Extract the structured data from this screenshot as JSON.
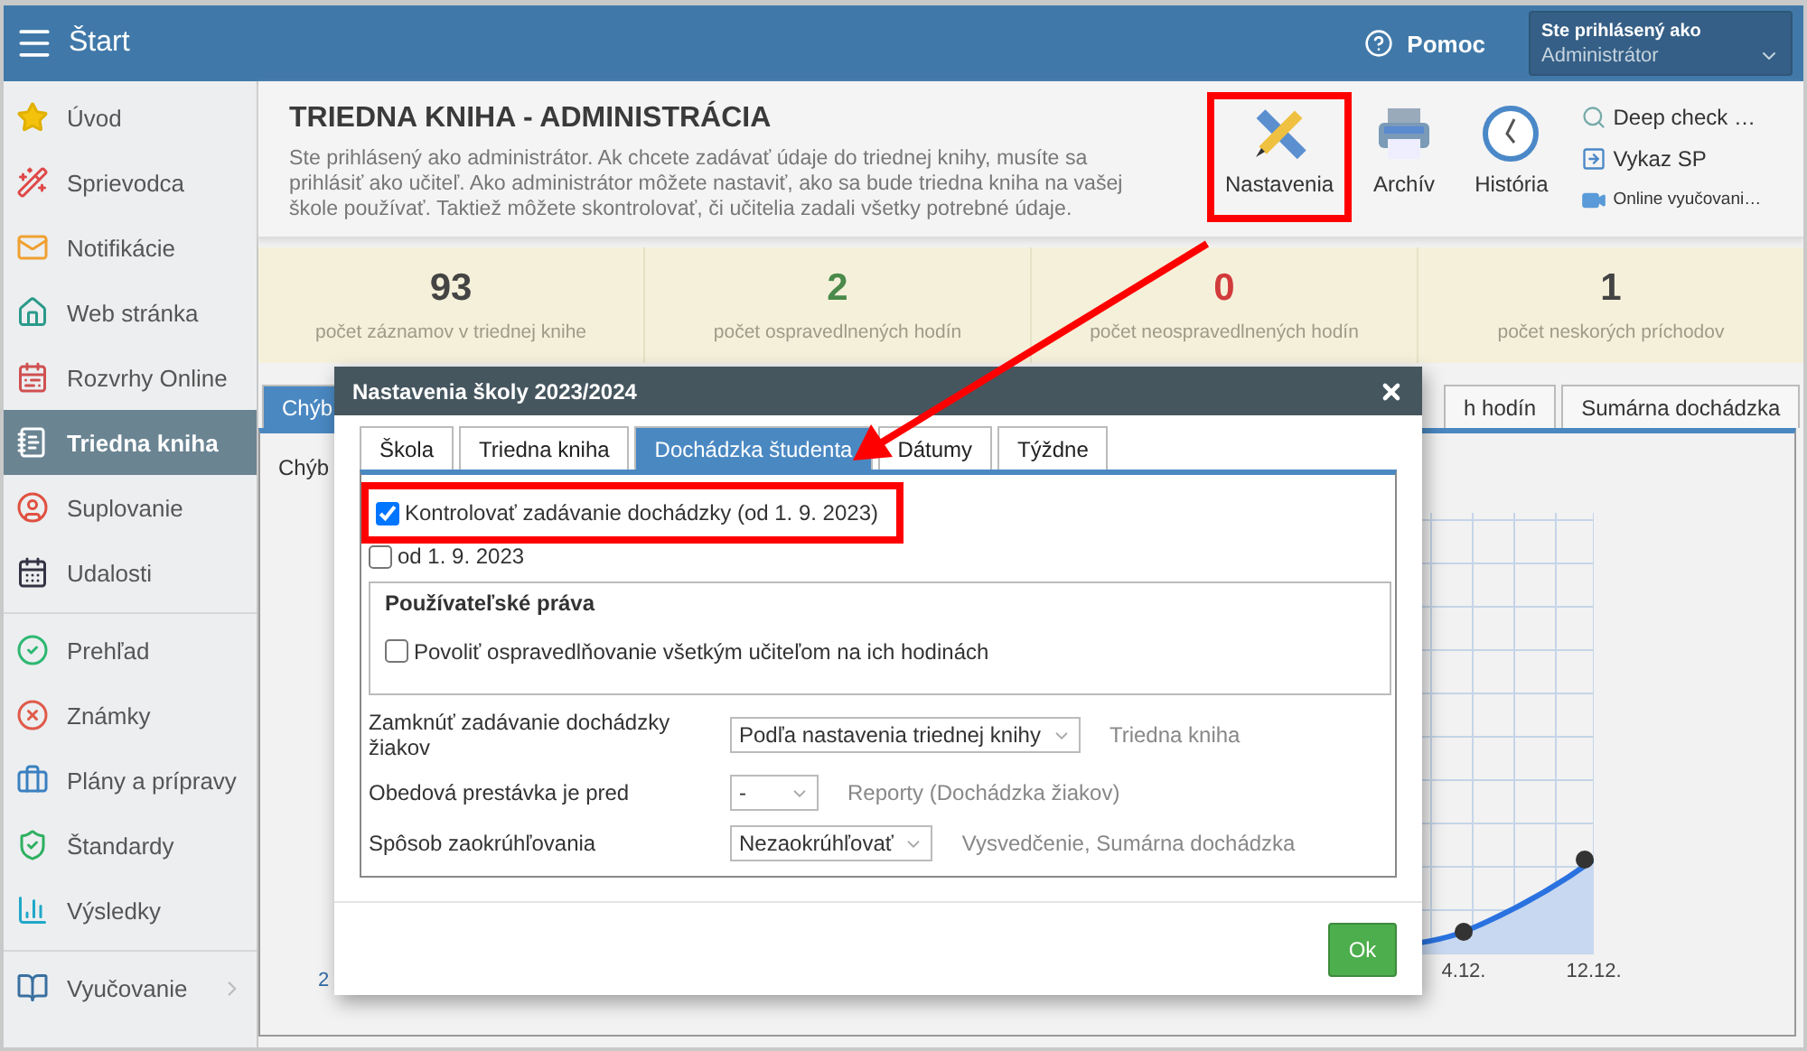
{
  "topbar": {
    "title": "Štart",
    "help": "Pomoc",
    "user_label": "Ste prihlásený ako",
    "user_name": "Administrátor"
  },
  "sidebar": {
    "sections": [
      {
        "items": [
          {
            "label": "Úvod",
            "selected": false,
            "kind": "link"
          },
          {
            "label": "Sprievodca",
            "selected": false,
            "kind": "link"
          },
          {
            "label": "Notifikácie",
            "selected": false,
            "kind": "link"
          },
          {
            "label": "Web stránka",
            "selected": false,
            "kind": "link"
          },
          {
            "label": "Rozvrhy Online",
            "selected": false,
            "kind": "link"
          },
          {
            "label": "Triedna kniha",
            "selected": true,
            "kind": "link"
          },
          {
            "label": "Suplovanie",
            "selected": false,
            "kind": "link"
          },
          {
            "label": "Udalosti",
            "selected": false,
            "kind": "link"
          }
        ]
      },
      {
        "items": [
          {
            "label": "Prehľad",
            "selected": false,
            "kind": "link"
          },
          {
            "label": "Známky",
            "selected": false,
            "kind": "link"
          },
          {
            "label": "Plány a prípravy",
            "selected": false,
            "kind": "link"
          },
          {
            "label": "Štandardy",
            "selected": false,
            "kind": "link"
          },
          {
            "label": "Výsledky",
            "selected": false,
            "kind": "link"
          }
        ]
      },
      {
        "items": [
          {
            "label": "Vyučovanie",
            "selected": false,
            "kind": "submenu"
          }
        ]
      }
    ]
  },
  "header": {
    "title": "TRIEDNA KNIHA - ADMINISTRÁCIA",
    "description": "Ste prihlásený ako administrátor. Ak chcete zadávať údaje do triednej knihy, musíte sa prihlásiť ako učiteľ. Ako administrátor môžete nastaviť, ako sa bude triedna kniha na vašej škole používať. Taktiež môžete skontrolovať, či učitelia zadali všetky potrebné údaje.",
    "tools": [
      {
        "label": "Nastavenia",
        "highlighted": true
      },
      {
        "label": "Archív",
        "highlighted": false
      },
      {
        "label": "História",
        "highlighted": false
      }
    ],
    "links": [
      "Deep check …",
      "Vykaz SP",
      "Online vyučovani…"
    ]
  },
  "stats": [
    {
      "value": "93",
      "label": "počet záznamov v triednej knihe",
      "color": "#444444"
    },
    {
      "value": "2",
      "label": "počet ospravedlnených hodín",
      "color": "#4a8a4a"
    },
    {
      "value": "0",
      "label": "počet neospravedlnených hodín",
      "color": "#d23b3b"
    },
    {
      "value": "1",
      "label": "počet neskorých príchodov",
      "color": "#444444"
    }
  ],
  "tabs": [
    {
      "label": "Chýb",
      "selected": true
    },
    {
      "label": "h hodín",
      "selected": false
    },
    {
      "label": "Sumárna dochádzka",
      "selected": false
    }
  ],
  "content": {
    "heading": "Chýb",
    "axis_start": "2",
    "x_labels": [
      "4.12.",
      "12.12."
    ]
  },
  "dialog": {
    "title": "Nastavenia školy 2023/2024",
    "tabs": [
      {
        "label": "Škola",
        "selected": false
      },
      {
        "label": "Triedna kniha",
        "selected": false
      },
      {
        "label": "Dochádzka študenta",
        "selected": true
      },
      {
        "label": "Dátumy",
        "selected": false
      },
      {
        "label": "Týždne",
        "selected": false
      }
    ],
    "options": [
      {
        "label": "Kontrolovať zadávanie dochádzky (od 1. 9. 2023)",
        "checked": true,
        "highlighted": true
      },
      {
        "label": "od 1. 9. 2023",
        "checked": false,
        "highlighted": false
      }
    ],
    "rights": {
      "title": "Používateľské práva",
      "options": [
        {
          "label": "Povoliť ospravedlňovanie všetkým učiteľom na ich hodinách",
          "checked": false
        }
      ]
    },
    "fields": [
      {
        "label": "Zamknúť zadávanie dochádzky žiakov",
        "value": "Podľa nastavenia triednej knihy",
        "note": "Triedna kniha"
      },
      {
        "label": "Obedová prestávka je pred",
        "value": "-",
        "note": "Reporty (Dochádzka žiakov)"
      },
      {
        "label": "Spôsob zaokrúhľovania",
        "value": "Nezaokrúhľovať",
        "note": "Vysvedčenie, Sumárna dochádzka"
      }
    ],
    "ok": "Ok"
  }
}
